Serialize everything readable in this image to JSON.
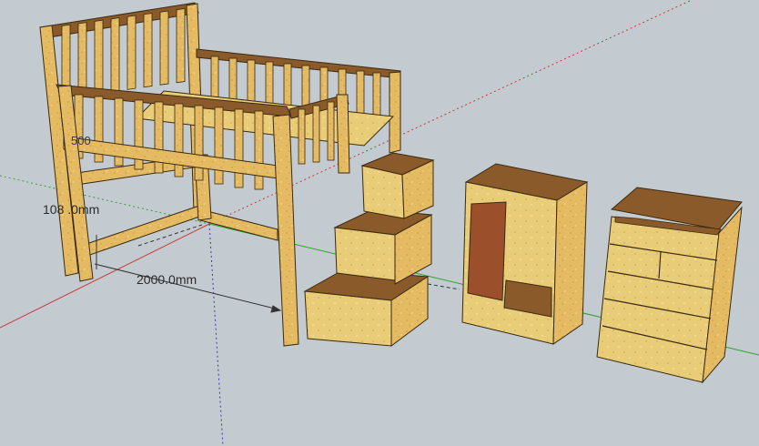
{
  "app": {
    "name": "",
    "viewport_background": "#c3cbd1"
  },
  "model": {
    "objects": [
      {
        "name": "loft-bed",
        "material_color": "#e2b55c"
      },
      {
        "name": "step-storage",
        "material_color": "#e6c46a"
      },
      {
        "name": "wardrobe",
        "material_color": "#e6c46a",
        "door_color": "#9b4f2a"
      },
      {
        "name": "chest-of-drawers",
        "material_color": "#e6c46a"
      }
    ],
    "axes": {
      "red": "#c83a3a",
      "green": "#2aa52a",
      "blue": "#3a3aa0"
    }
  },
  "dimensions": {
    "height_label": "108 .0mm",
    "length_label": "2000.0mm",
    "small_label": "500"
  }
}
